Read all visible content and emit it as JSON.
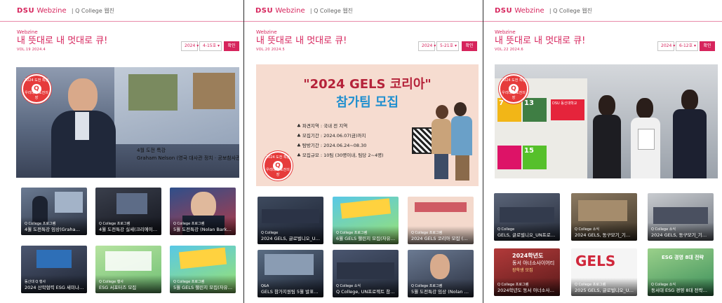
{
  "header": {
    "logo": "DSU",
    "brand": "Webzine",
    "sub": "| Q College 웹진"
  },
  "panels": [
    {
      "label": "Webzine",
      "title": "내 뜻대로 내 멋대로 큐!",
      "vol": "VOL.19 2024.4",
      "year": "2024",
      "issue": "4-15호",
      "button": "확인",
      "hero": {
        "caption_line1": "4월 도전 특강",
        "caption_line2": "Graham Nelson (영국 대사관 정치 · 공보참사관)",
        "badge_top": "2024 도전 특강",
        "badge_bottom": "우리대학 도전의 장"
      },
      "thumbs": [
        {
          "tag": "Q College 프로그램",
          "title": "4월 도전특강 임상(Graham N..."
        },
        {
          "tag": "Q College 프로그램",
          "title": "4월 도전특강 실세(크리에이터 ..."
        },
        {
          "tag": "Q College 프로그램",
          "title": "5월 도전특강 (Nolan Barkhou..."
        },
        {
          "tag": "동신대 Q 행사",
          "title": "2024 산학협력 ESG 세미나 ..."
        },
        {
          "tag": "Q College 행사",
          "title": "ESG 서포터즈 모집"
        },
        {
          "tag": "Q College 프로그램",
          "title": "5월 GELS 챌린지 모집(자유선..."
        }
      ]
    },
    {
      "label": "Webzine",
      "title": "내 뜻대로 내 멋대로 큐!",
      "vol": "VOL.20 2024.5",
      "year": "2024",
      "issue": "5-21호",
      "button": "확인",
      "hero": {
        "poster_title": "\"2024 GELS 코리아\"",
        "poster_sub": "참가팀 모집",
        "bullets": [
          "♣ 파견지역 : 국내 전 지역",
          "♣ 모집기간 : 2024.06.07(금)까지",
          "♣ 탐방기간 : 2024.06.24~08.30",
          "♣ 모집규모 : 10팀 (30명이내, 팀당 2~4명)"
        ],
        "badge_top": "2024 도전 특강",
        "badge_bottom": "우리대학 도전의 장"
      },
      "thumbs": [
        {
          "tag": "Q College",
          "title": "2024 GELS, 글로벌니오_UN프..."
        },
        {
          "tag": "Q College 프로그램",
          "title": "6월 GELS 챌린지 모집(자유선..."
        },
        {
          "tag": "Q College 프로그램",
          "title": "2024 GELS 코리아 모집 (국내..."
        },
        {
          "tag": "Q&A",
          "title": "GELS 참가지원팀 5월 발표행..."
        },
        {
          "tag": "Q College 소식",
          "title": "Q College, UN프로젝트 참 증..."
        },
        {
          "tag": "Q College 프로그램",
          "title": "5월 도전특강 임상 (Nolan Bar..."
        }
      ]
    },
    {
      "label": "Webzine",
      "title": "내 뜻대로 내 멋대로 큐!",
      "vol": "VOL.22 2024.6",
      "year": "2024",
      "issue": "6-12호",
      "button": "확인",
      "hero": {
        "badge_top": "2024 도전 특강",
        "badge_bottom": "우리대학 도전의 장",
        "sdg_title": "DSU 동신대학교",
        "sdg_7": "7",
        "sdg_13": "13",
        "sdg_15": "15"
      },
      "thumbs": [
        {
          "tag": "Q College",
          "title": "GELS, 글로벌니오_UN프로젝트..."
        },
        {
          "tag": "Q College 소식",
          "title": "2024 GELS, 동구모기_기업인..."
        },
        {
          "tag": "Q College 소식",
          "title": "2024 GELS, 동구모기_기업인..."
        },
        {
          "tag": "Q College 프로그램",
          "title": "2024학년도 동서 아너소사이어..."
        },
        {
          "tag": "Q College 프로그램",
          "title": "2025 GELS, 글로벌니오_UN프..."
        },
        {
          "tag": "Q College 소식",
          "title": "동서대 ESG 경영 8대 전략을 ..."
        }
      ],
      "thumb_posters": {
        "honor_title": "2024학년도",
        "honor_sub": "동서 아너소사이어티",
        "honor_sub2": "장학생 모집",
        "gels": "GELS",
        "esg": "ESG 경영 8대 전략"
      }
    }
  ],
  "colors": {
    "accent": "#d6245c",
    "badge": "#e63b3b"
  }
}
